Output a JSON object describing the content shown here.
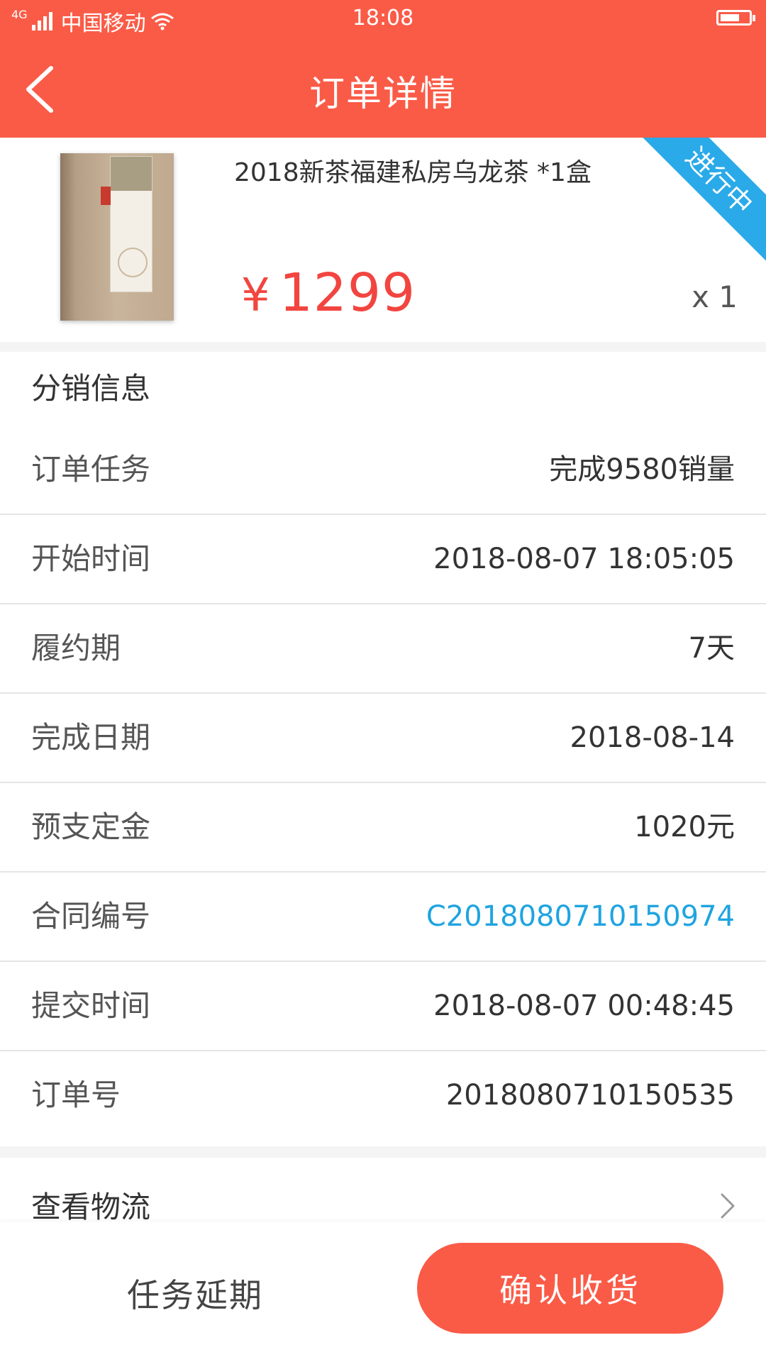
{
  "status_bar": {
    "network_tag": "4G",
    "carrier": "中国移动",
    "time": "18:08"
  },
  "header": {
    "title": "订单详情",
    "back_icon": "chevron-left-icon",
    "background_color": "#fa5b47"
  },
  "product": {
    "name": "2018新茶福建私房乌龙茶 *1盒",
    "currency_symbol": "¥",
    "price": "1299",
    "quantity": "x 1",
    "status_ribbon": "进行中",
    "ribbon_color": "#2aaae8",
    "price_color": "#f2453f"
  },
  "info": {
    "section_title": "分销信息",
    "rows": [
      {
        "label": "订单任务",
        "value": "完成9580销量"
      },
      {
        "label": "开始时间",
        "value": "2018-08-07 18:05:05"
      },
      {
        "label": "履约期",
        "value": "7天"
      },
      {
        "label": "完成日期",
        "value": "2018-08-14"
      },
      {
        "label": "预支定金",
        "value": "1020元"
      },
      {
        "label": "合同编号",
        "value": "C2018080710150974"
      },
      {
        "label": "提交时间",
        "value": "2018-08-07 00:48:45"
      },
      {
        "label": "订单号",
        "value": "2018080710150535"
      }
    ],
    "link_color": "#1fa4e0"
  },
  "logistics": {
    "label": "查看物流",
    "icon": "chevron-right-icon"
  },
  "actions": {
    "delay_label": "任务延期",
    "confirm_label": "确认收货"
  }
}
